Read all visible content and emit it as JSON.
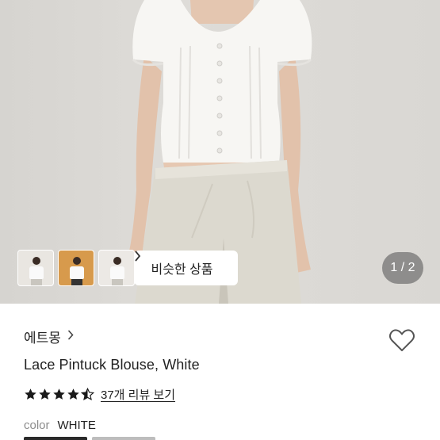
{
  "gallery": {
    "similar_button_label": "비슷한 상품",
    "page_indicator": "1 / 2",
    "thumbnails": [
      "thumbnail-1",
      "thumbnail-2",
      "thumbnail-3"
    ]
  },
  "product": {
    "brand": "에트몽",
    "name": "Lace Pintuck Blouse, White",
    "rating": 4.5,
    "review_link": "37개 리뷰 보기",
    "color_label": "color",
    "color_value": "WHITE"
  },
  "colors": {
    "star": "#1a1a1a",
    "heart_stroke": "#555555",
    "page_indicator_bg": "#505050"
  },
  "icons": {
    "brand_chevron": "chevron-right-icon",
    "similar_chevron": "chevron-right-icon",
    "wishlist": "heart-icon",
    "star": "star-icon"
  }
}
